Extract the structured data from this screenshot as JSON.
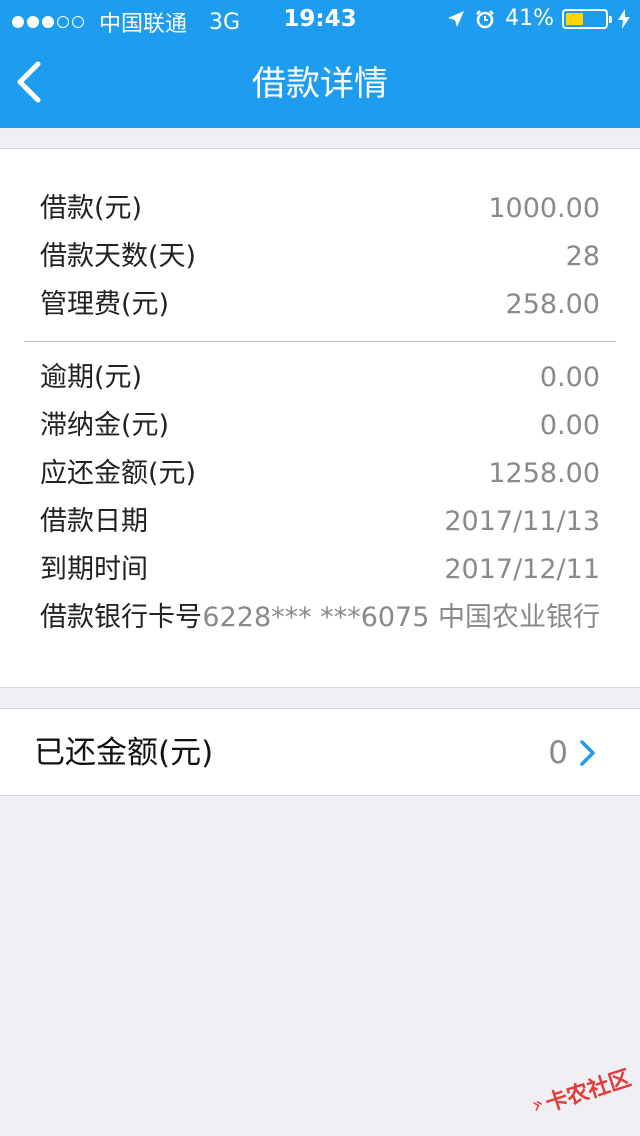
{
  "status_bar": {
    "carrier": "中国联通",
    "network": "3G",
    "time": "19:43",
    "battery": "41%",
    "signal_bars": 3,
    "signal_total": 5,
    "battery_level": 0.41,
    "battery_color": "#ffd400"
  },
  "nav": {
    "back_icon": "chevron-left-icon",
    "title": "借款详情"
  },
  "details": {
    "group1": [
      {
        "label": "借款(元)",
        "value": "1000.00"
      },
      {
        "label": "借款天数(天)",
        "value": "28"
      },
      {
        "label": "管理费(元)",
        "value": "258.00"
      }
    ],
    "group2": [
      {
        "label": "逾期(元)",
        "value": "0.00"
      },
      {
        "label": "滞纳金(元)",
        "value": "0.00"
      },
      {
        "label": "应还金额(元)",
        "value": "1258.00"
      },
      {
        "label": "借款日期",
        "value": "2017/11/13"
      },
      {
        "label": "到期时间",
        "value": "2017/12/11"
      },
      {
        "label": "借款银行卡号",
        "value": "6228*** ***6075 中国农业银行"
      }
    ]
  },
  "repaid": {
    "label": "已还金额(元)",
    "value": "0",
    "chevron_icon": "chevron-right-icon"
  },
  "watermark": {
    "text": "卡农社区"
  },
  "colors": {
    "header": "#1e9cf0",
    "background": "#efeff4",
    "accent": "#1e9cf0"
  }
}
